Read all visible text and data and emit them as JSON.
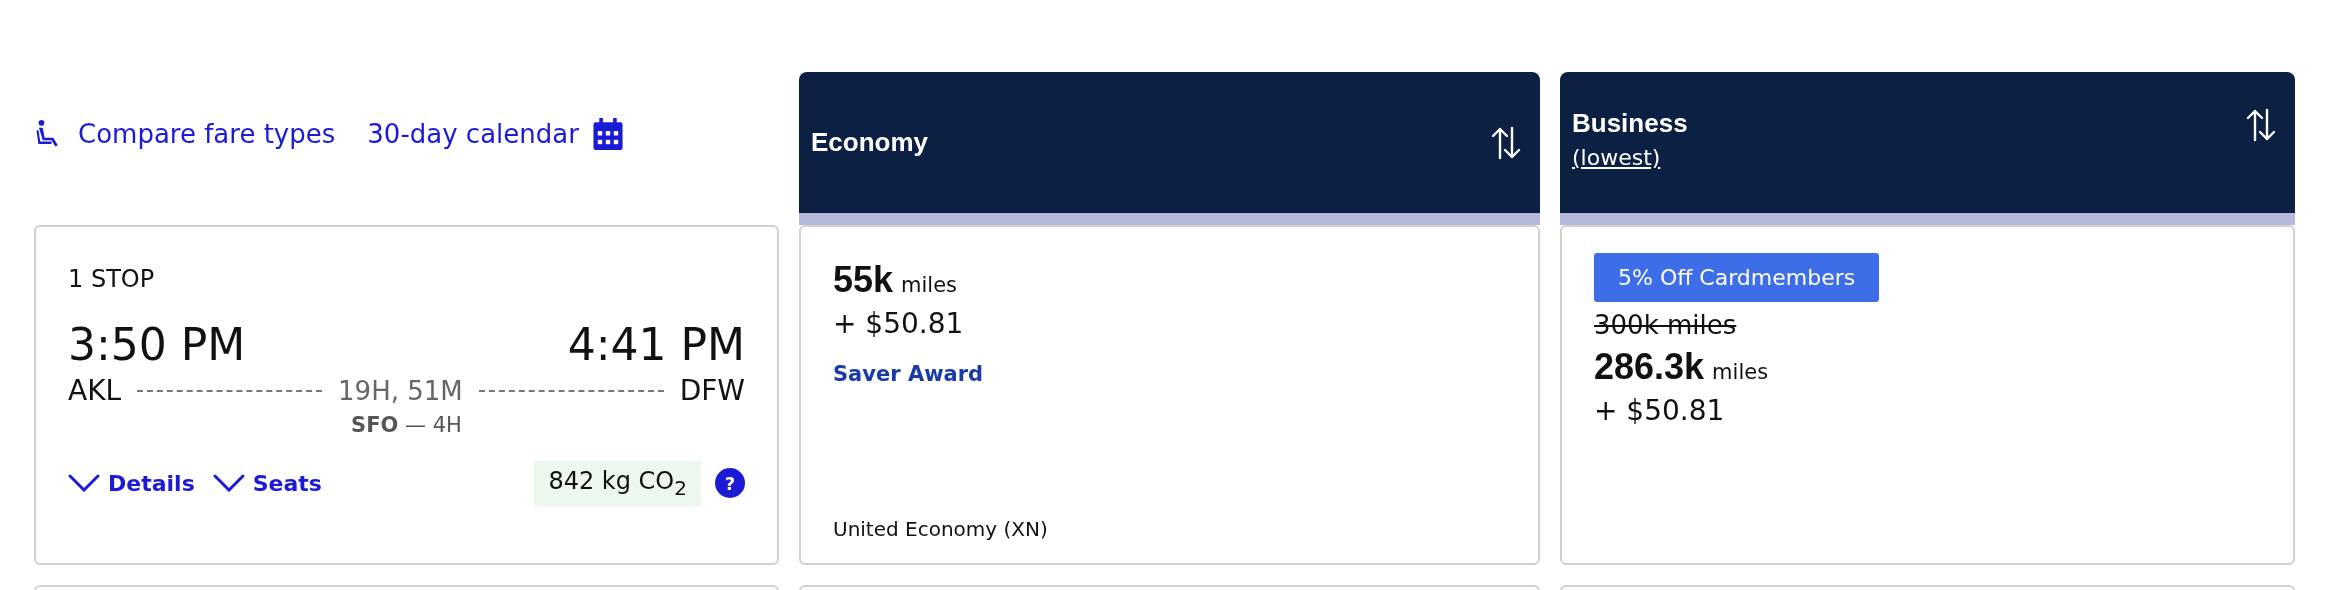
{
  "toolbar": {
    "links": [
      {
        "label": "Compare fare types",
        "kind": "seat"
      },
      {
        "label": "30-day calendar",
        "kind": "calendar"
      }
    ]
  },
  "flight": {
    "stops": "1 STOP",
    "depart_time": "3:50 PM",
    "arrive_time": "4:41 PM",
    "origin": "AKL",
    "destination": "DFW",
    "duration": "19H, 51M",
    "layover": "**SFO** — 4H",
    "actions": [
      "Details",
      "Seats"
    ],
    "emissions": "842 kg CO$_{2}$",
    "help": "?"
  },
  "fare_columns": [
    {
      "title": "Economy",
      "fare": {
        "miles": "55k",
        "miles_unit": "miles",
        "fees": "+ $50.81",
        "award_type": "Saver Award",
        "fare_class": "United Economy (XN)"
      }
    },
    {
      "title": "Business",
      "subtitle": "(lowest)",
      "fare": {
        "badge": "5% Off Cardmembers",
        "original_price": "300k miles",
        "miles": "286.3k",
        "miles_unit": "miles",
        "fees": "+ $50.81"
      }
    }
  ]
}
